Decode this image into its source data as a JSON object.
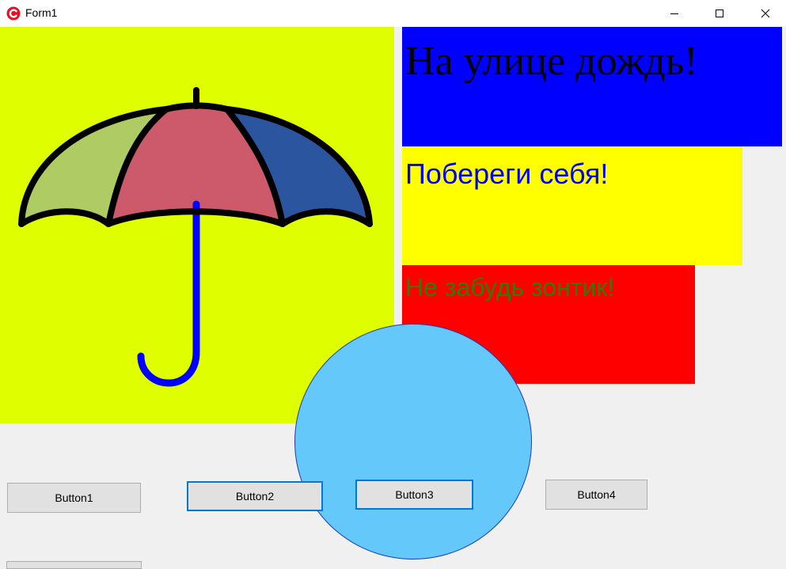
{
  "window": {
    "title": "Form1",
    "icon": "app-logo-icon",
    "controls": [
      "minimize-icon",
      "maximize-icon",
      "close-icon"
    ]
  },
  "panels": {
    "blue_text": "На улице дождь!",
    "yellow_text": "Побереги себя!",
    "red_text": "Не забудь зонтик!"
  },
  "umbrella": {
    "icon": "umbrella-icon",
    "colors": {
      "background": "#dfff00",
      "left_segment": "#aecb64",
      "center_segment": "#cc5a6b",
      "right_segment": "#2c55a0",
      "handle": "#0000ff"
    }
  },
  "buttons": [
    "Button1",
    "Button2",
    "Button3",
    "Button4"
  ],
  "colors": {
    "blue_panel": "#0000ff",
    "yellow_panel": "#ffff00",
    "red_panel": "#ff0000",
    "circle": "#64c8fa",
    "focus_border": "#0078d7"
  }
}
